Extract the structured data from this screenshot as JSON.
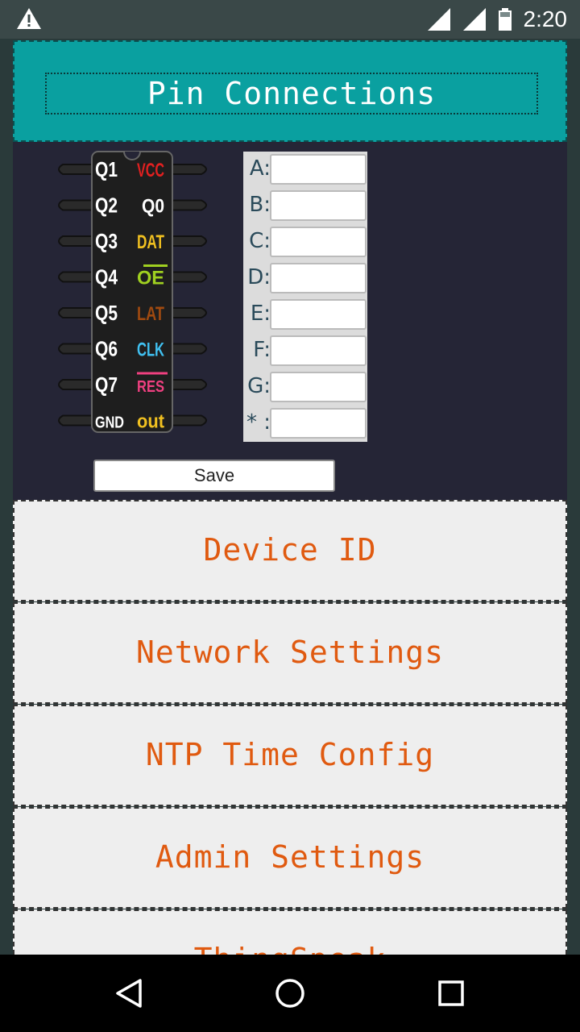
{
  "status_bar": {
    "time": "2:20",
    "icons": [
      "warning-icon",
      "signal-icon",
      "signal-icon",
      "battery-icon"
    ]
  },
  "header": {
    "title": "Pin Connections"
  },
  "chip": {
    "left_pins": [
      "Q1",
      "Q2",
      "Q3",
      "Q4",
      "Q5",
      "Q6",
      "Q7",
      "GND"
    ],
    "right_pins": [
      "VCC",
      "Q0",
      "DAT",
      "OE",
      "LAT",
      "CLK",
      "RES",
      "out"
    ],
    "right_pin_colors": [
      "#e02020",
      "#ffffff",
      "#f0c020",
      "#a0d020",
      "#a04a10",
      "#40c0f0",
      "#f04080",
      "#f0c020"
    ]
  },
  "pin_form": {
    "rows": [
      {
        "label": "A:",
        "value": ""
      },
      {
        "label": "B:",
        "value": ""
      },
      {
        "label": "C:",
        "value": ""
      },
      {
        "label": "D:",
        "value": ""
      },
      {
        "label": "E:",
        "value": ""
      },
      {
        "label": "F:",
        "value": ""
      },
      {
        "label": "G:",
        "value": ""
      },
      {
        "label": "* :",
        "value": ""
      }
    ],
    "save_label": "Save"
  },
  "menu": {
    "items": [
      "Device ID",
      "Network Settings",
      "NTP Time Config",
      "Admin Settings",
      "ThingSpeak"
    ]
  },
  "nav_bar": {
    "icons": [
      "back-icon",
      "home-icon",
      "recents-icon"
    ]
  }
}
